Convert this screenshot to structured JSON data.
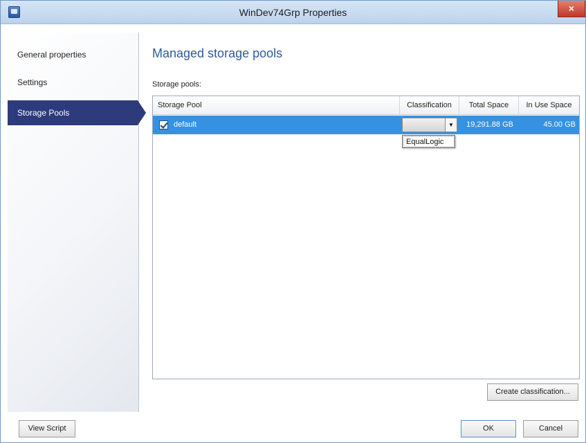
{
  "window": {
    "title": "WinDev74Grp Properties",
    "close_glyph": "×",
    "app_icon": "window-app-icon"
  },
  "sidebar": {
    "items": [
      {
        "label": "General properties",
        "selected": false
      },
      {
        "label": "Settings",
        "selected": false
      },
      {
        "label": "Storage Pools",
        "selected": true
      }
    ]
  },
  "main": {
    "title": "Managed storage pools",
    "pools_label": "Storage pools:",
    "columns": [
      "Storage Pool",
      "Classification",
      "Total Space",
      "In Use Space"
    ],
    "rows": [
      {
        "checked": true,
        "name": "default",
        "classification": "",
        "total_space": "19,291.88 GB",
        "in_use_space": "45.00 GB"
      }
    ],
    "dropdown": {
      "arrow_glyph": "▼",
      "options": [
        "EqualLogic"
      ]
    },
    "create_classification_label": "Create classification..."
  },
  "footer": {
    "view_script_label": "View Script",
    "ok_label": "OK",
    "cancel_label": "Cancel"
  },
  "colors": {
    "selected_nav": "#2d3b7d",
    "selected_row": "#3592e2",
    "title_accent": "#2f5a9a"
  }
}
